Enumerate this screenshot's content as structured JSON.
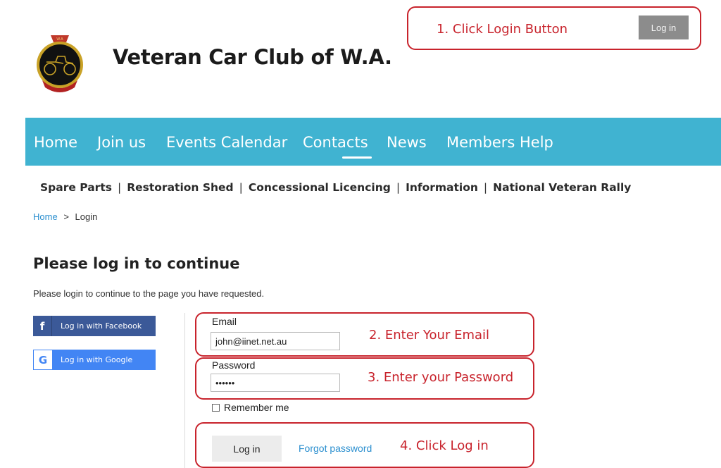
{
  "header": {
    "site_title": "Veteran Car Club of W.A.",
    "top_login_label": "Log in"
  },
  "nav": {
    "items": [
      "Home",
      "Join us",
      "Events Calendar",
      "Contacts",
      "News",
      "Members Help"
    ],
    "active": "Contacts"
  },
  "subnav": {
    "items": [
      "Spare Parts",
      "Restoration Shed",
      "Concessional Licencing",
      "Information",
      "National Veteran Rally"
    ],
    "separator": "|"
  },
  "breadcrumb": {
    "home": "Home",
    "sep": ">",
    "current": "Login"
  },
  "login": {
    "title": "Please log in to continue",
    "intro": "Please login to continue to the page you have requested.",
    "facebook_label": "Log in with Facebook",
    "google_label": "Log in with Google",
    "facebook_icon_glyph": "f",
    "google_icon_glyph": "G",
    "email_label": "Email",
    "email_value": "john@iinet.net.au",
    "password_label": "Password",
    "password_value": "••••••",
    "remember_label": "Remember me",
    "submit_label": "Log in",
    "forgot_label": "Forgot password"
  },
  "annotations": {
    "step1": "1. Click Login Button",
    "step2": "2. Enter Your Email",
    "step3": "3. Enter your Password",
    "step4": "4. Click Log in",
    "color": "#c8232c"
  },
  "colors": {
    "nav_bg": "#40b3d1",
    "facebook": "#3b5998",
    "google": "#4285f4",
    "link": "#2b8fcf"
  }
}
